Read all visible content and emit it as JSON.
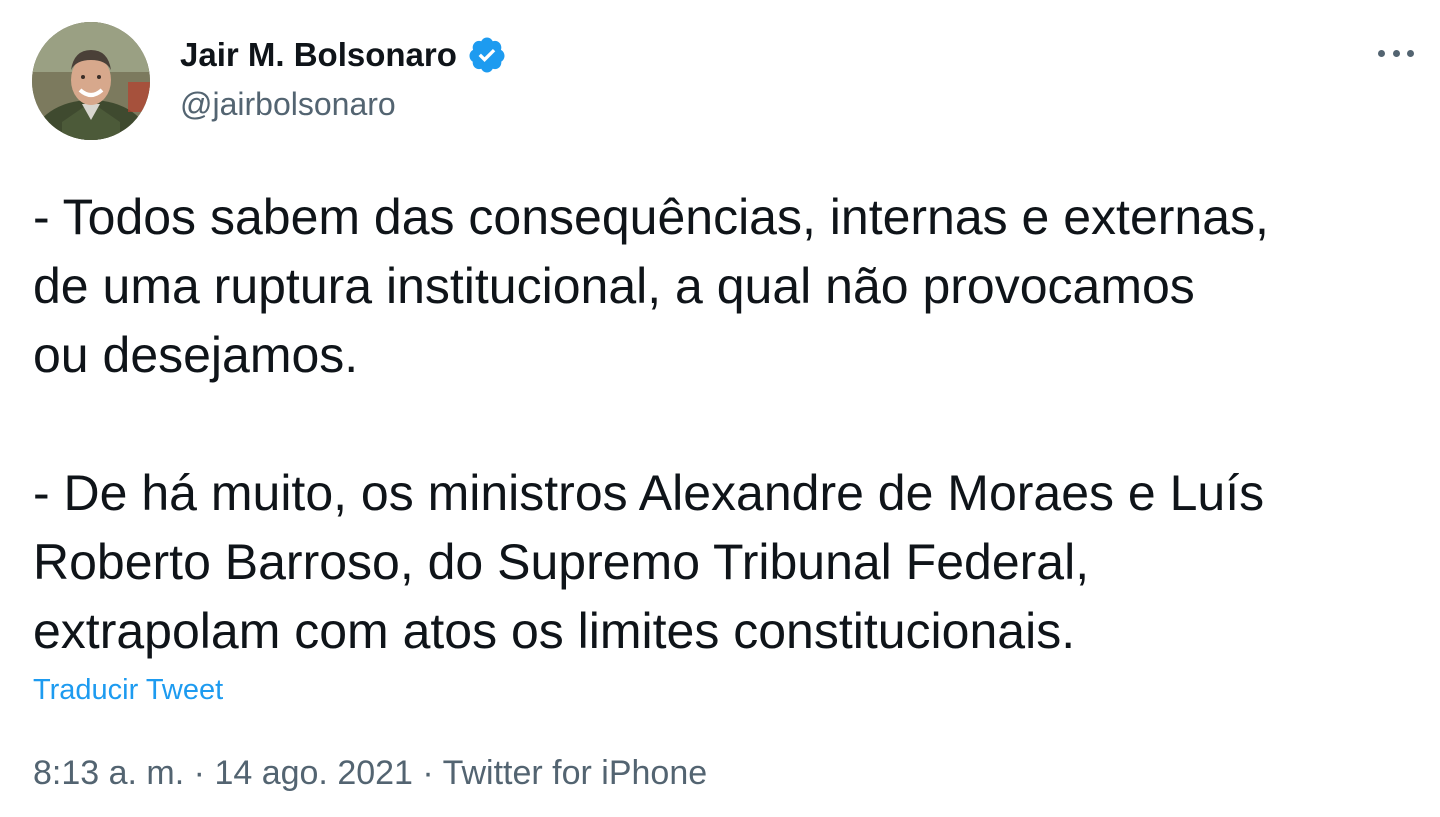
{
  "user": {
    "display_name": "Jair M. Bolsonaro",
    "handle": "@jairbolsonaro",
    "verified": true,
    "verified_color": "#1d9bf0"
  },
  "tweet": {
    "lines": [
      "- Todos sabem das consequências, internas e externas,",
      "de uma ruptura institucional, a qual não provocamos",
      "ou desejamos.",
      "",
      "- De há muito, os ministros Alexandre de Moraes e Luís",
      "Roberto Barroso, do Supremo Tribunal Federal,",
      "extrapolam com atos os limites constitucionais."
    ],
    "translate_label": "Traducir Tweet",
    "time": "8:13 a. m.",
    "date": "14 ago. 2021",
    "source": "Twitter for iPhone",
    "separator": "·"
  },
  "icons": {
    "avatar": "profile-photo",
    "verified": "verified-badge-icon",
    "more": "more-options-icon"
  },
  "colors": {
    "text": "#0f1419",
    "secondary": "#536471",
    "link": "#1d9bf0"
  }
}
